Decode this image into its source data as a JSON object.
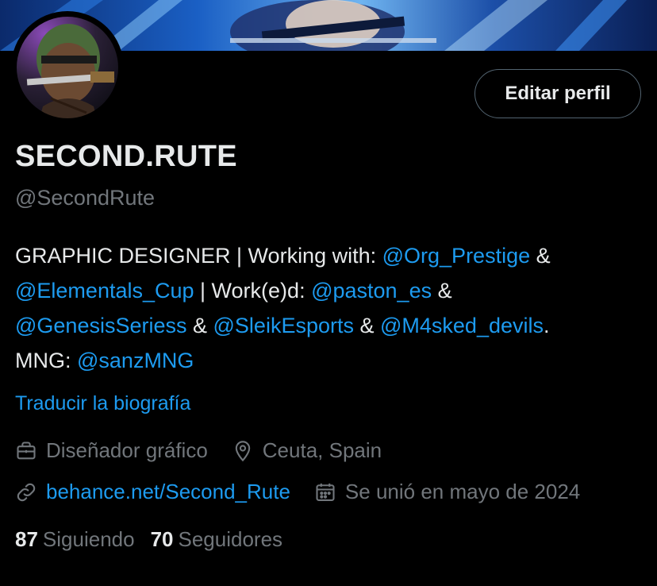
{
  "profile": {
    "display_name": "SECOND.RUTE",
    "handle": "@SecondRute",
    "edit_button": "Editar perfil"
  },
  "bio": {
    "line1": {
      "t1": "GRAPHIC DESIGNER | Working with: ",
      "m1": "@Org_Prestige",
      "t2": " &"
    },
    "line2": {
      "m1": "@Elementals_Cup",
      "t1": " | Work(e)d: ",
      "m2": "@paston_es",
      "t2": " &"
    },
    "line3": {
      "m1": "@GenesisSeriess",
      "t1": " & ",
      "m2": "@SleikEsports",
      "t2": " & ",
      "m3": "@M4sked_devils",
      "t3": "."
    },
    "line4": {
      "t1": "MNG: ",
      "m1": "@sanzMNG"
    }
  },
  "translate_link": "Traducir la biografía",
  "meta": {
    "profession": {
      "icon": "briefcase-icon",
      "label": "Diseñador gráfico"
    },
    "location": {
      "icon": "location-pin-icon",
      "label": "Ceuta, Spain"
    },
    "website": {
      "icon": "link-icon",
      "label": "behance.net/Second_Rute"
    },
    "joined": {
      "icon": "calendar-icon",
      "label": "Se unió en mayo de 2024"
    }
  },
  "stats": {
    "following_count": "87",
    "following_label": "Siguiendo",
    "followers_count": "70",
    "followers_label": "Seguidores"
  },
  "colors": {
    "background": "#000000",
    "text": "#e7e9ea",
    "secondary_text": "#71767b",
    "link": "#1d9bf0",
    "border": "#536471"
  }
}
